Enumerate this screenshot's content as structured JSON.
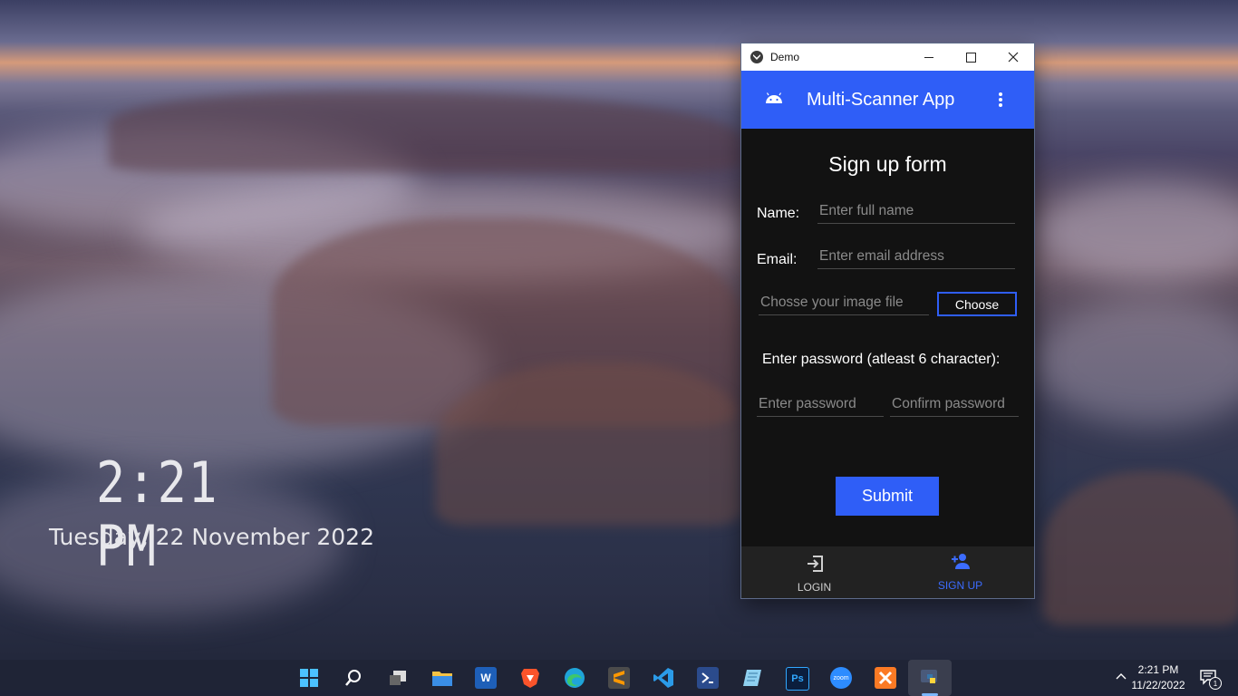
{
  "desktop": {
    "clock_time": "2:21 PM",
    "clock_date": "Tuesday, 22 November 2022"
  },
  "window": {
    "title": "Demo",
    "app_title": "Multi-Scanner App",
    "form_title": "Sign up form",
    "name_label": "Name:",
    "name_placeholder": "Enter full name",
    "email_label": "Email:",
    "email_placeholder": "Enter email address",
    "image_placeholder": "Chosse your image file",
    "choose_button": "Choose",
    "password_label": "Enter password (atleast 6 character):",
    "password_placeholder": "Enter password",
    "confirm_placeholder": "Confirm password",
    "submit_button": "Submit",
    "nav": {
      "login": "LOGIN",
      "signup": "SIGN UP"
    },
    "colors": {
      "accent": "#2f5ef7",
      "background": "#121212"
    }
  },
  "taskbar": {
    "icons": [
      "windows-start-icon",
      "search-icon",
      "task-view-icon",
      "file-explorer-icon",
      "word-icon",
      "brave-icon",
      "edge-icon",
      "sublime-icon",
      "vscode-icon",
      "powershell-icon",
      "notepad-icon",
      "photoshop-icon",
      "zoom-icon",
      "xampp-icon",
      "python-icon"
    ],
    "word_letter": "W",
    "ps_letters": "Ps",
    "zoom_text": "zoom",
    "time": "2:21 PM",
    "date": "11/22/2022",
    "notification_count": "1"
  }
}
